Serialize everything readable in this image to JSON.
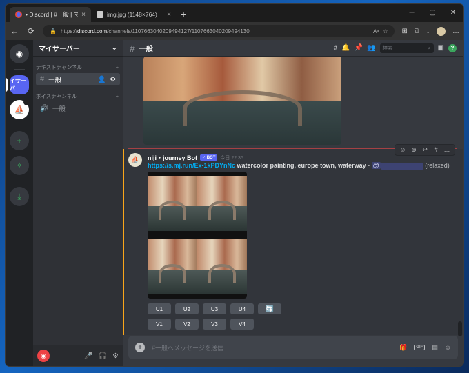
{
  "browser": {
    "tabs": [
      {
        "title": "• Discord | #一般 | マイサーバー",
        "close": "×"
      },
      {
        "title": "img.jpg (1148×764)",
        "close": "×"
      }
    ],
    "new_tab": "+",
    "window_controls": [
      "─",
      "▢",
      "✕"
    ],
    "nav": {
      "back": "←",
      "reload": "⟳"
    },
    "url_prefix": "https://",
    "url_host": "discord.com",
    "url_path": "/channels/1107663040209494127/1107663040209494130",
    "toolbar_icons": [
      "Aᵃ",
      "☆",
      "⊞",
      "⧉",
      "↓",
      "…"
    ]
  },
  "guilds": {
    "home_icon": "◉",
    "server_label": "イサーバ",
    "sail_icon": "⛵",
    "add_icon": "+",
    "explore_icon": "✧",
    "download_icon": "⤓"
  },
  "sidebar": {
    "server_name": "マイサーバー",
    "chevron": "⌄",
    "text_category": "テキストチャンネル",
    "voice_category": "ボイスチャンネル",
    "add": "+",
    "text_channels": [
      {
        "label": "一般"
      }
    ],
    "voice_channels": [
      {
        "label": "一般"
      }
    ],
    "user_icons": [
      "🎤",
      "🎧",
      "⚙"
    ]
  },
  "header": {
    "channel": "一般",
    "icons": [
      "#",
      "🔔",
      "📌",
      "👥"
    ],
    "search_placeholder": "検索",
    "search_icon": "⌕",
    "inbox_icon": "▣",
    "help_icon": "?"
  },
  "message": {
    "author": "niji・journey Bot",
    "badge": "✓ BOT",
    "time": "今日 22:35",
    "link": "https://s.mj.run/Ex-1kPDYnNc",
    "prompt": "watercolor painting, europe town, waterway",
    "dash": " - ",
    "mention": "@",
    "mode": "(relaxed)",
    "buttons_row1": [
      "U1",
      "U2",
      "U3",
      "U4"
    ],
    "reroll_icon": "🔄",
    "buttons_row2": [
      "V1",
      "V2",
      "V3",
      "V4"
    ],
    "toolbar": [
      "☺",
      "⊕",
      "↩",
      "#",
      "…"
    ]
  },
  "composer": {
    "placeholder": "#一般へメッセージを送信",
    "icons": [
      "🎁",
      "GIF",
      "▤",
      "☺"
    ]
  }
}
